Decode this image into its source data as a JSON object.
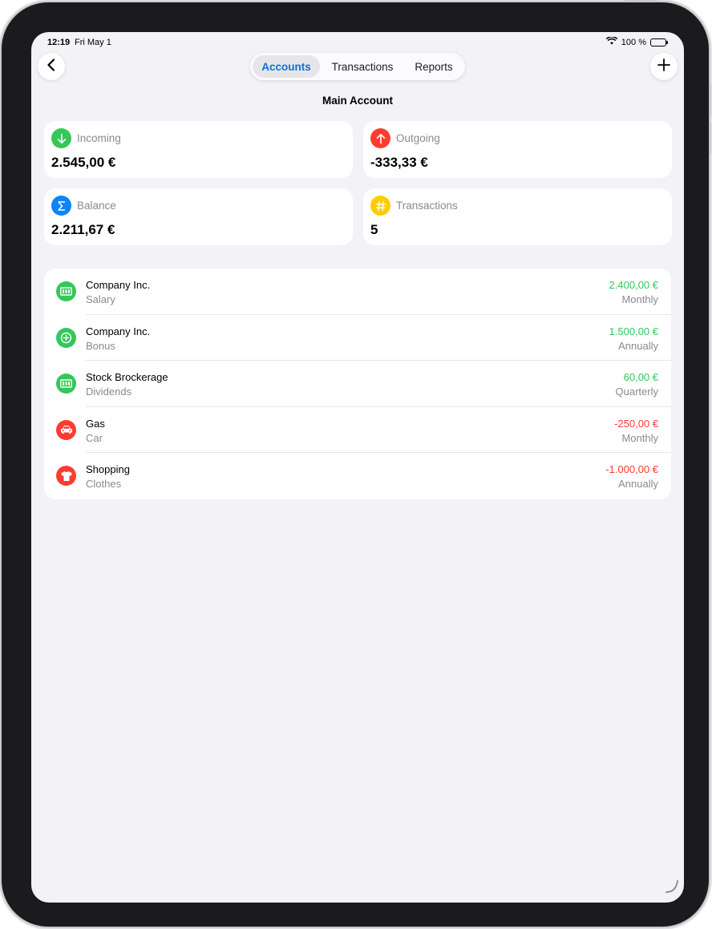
{
  "status_bar": {
    "time": "12:19",
    "date": "Fri May 1",
    "battery": "100 %"
  },
  "nav": {
    "tabs": [
      {
        "label": "Accounts",
        "active": true
      },
      {
        "label": "Transactions",
        "active": false
      },
      {
        "label": "Reports",
        "active": false
      }
    ]
  },
  "title": "Main Account",
  "summary": [
    {
      "label": "Incoming",
      "value": "2.545,00 €",
      "icon": "arrow-down-icon",
      "color": "#34c759"
    },
    {
      "label": "Outgoing",
      "value": "-333,33 €",
      "icon": "arrow-up-icon",
      "color": "#ff3b30"
    },
    {
      "label": "Balance",
      "value": "2.211,67 €",
      "icon": "sigma-icon",
      "color": "#0a84ff"
    },
    {
      "label": "Transactions",
      "value": "5",
      "icon": "number-icon",
      "color": "#ffcc00"
    }
  ],
  "transactions": [
    {
      "title": "Company Inc.",
      "subtitle": "Salary",
      "amount": "2.400,00 €",
      "frequency": "Monthly",
      "icon": "banknote-icon",
      "type": "income"
    },
    {
      "title": "Company Inc.",
      "subtitle": "Bonus",
      "amount": "1.500,00 €",
      "frequency": "Annually",
      "icon": "plus-circle-icon",
      "type": "income"
    },
    {
      "title": "Stock Brockerage",
      "subtitle": "Dividends",
      "amount": "60,00 €",
      "frequency": "Quarterly",
      "icon": "banknote-icon",
      "type": "income"
    },
    {
      "title": "Gas",
      "subtitle": "Car",
      "amount": "-250,00 €",
      "frequency": "Monthly",
      "icon": "car-icon",
      "type": "expense"
    },
    {
      "title": "Shopping",
      "subtitle": "Clothes",
      "amount": "-1.000,00 €",
      "frequency": "Annually",
      "icon": "tshirt-icon",
      "type": "expense"
    }
  ],
  "colors": {
    "income": "#34c759",
    "expense": "#ff3b30",
    "accent": "#0a72d9"
  }
}
